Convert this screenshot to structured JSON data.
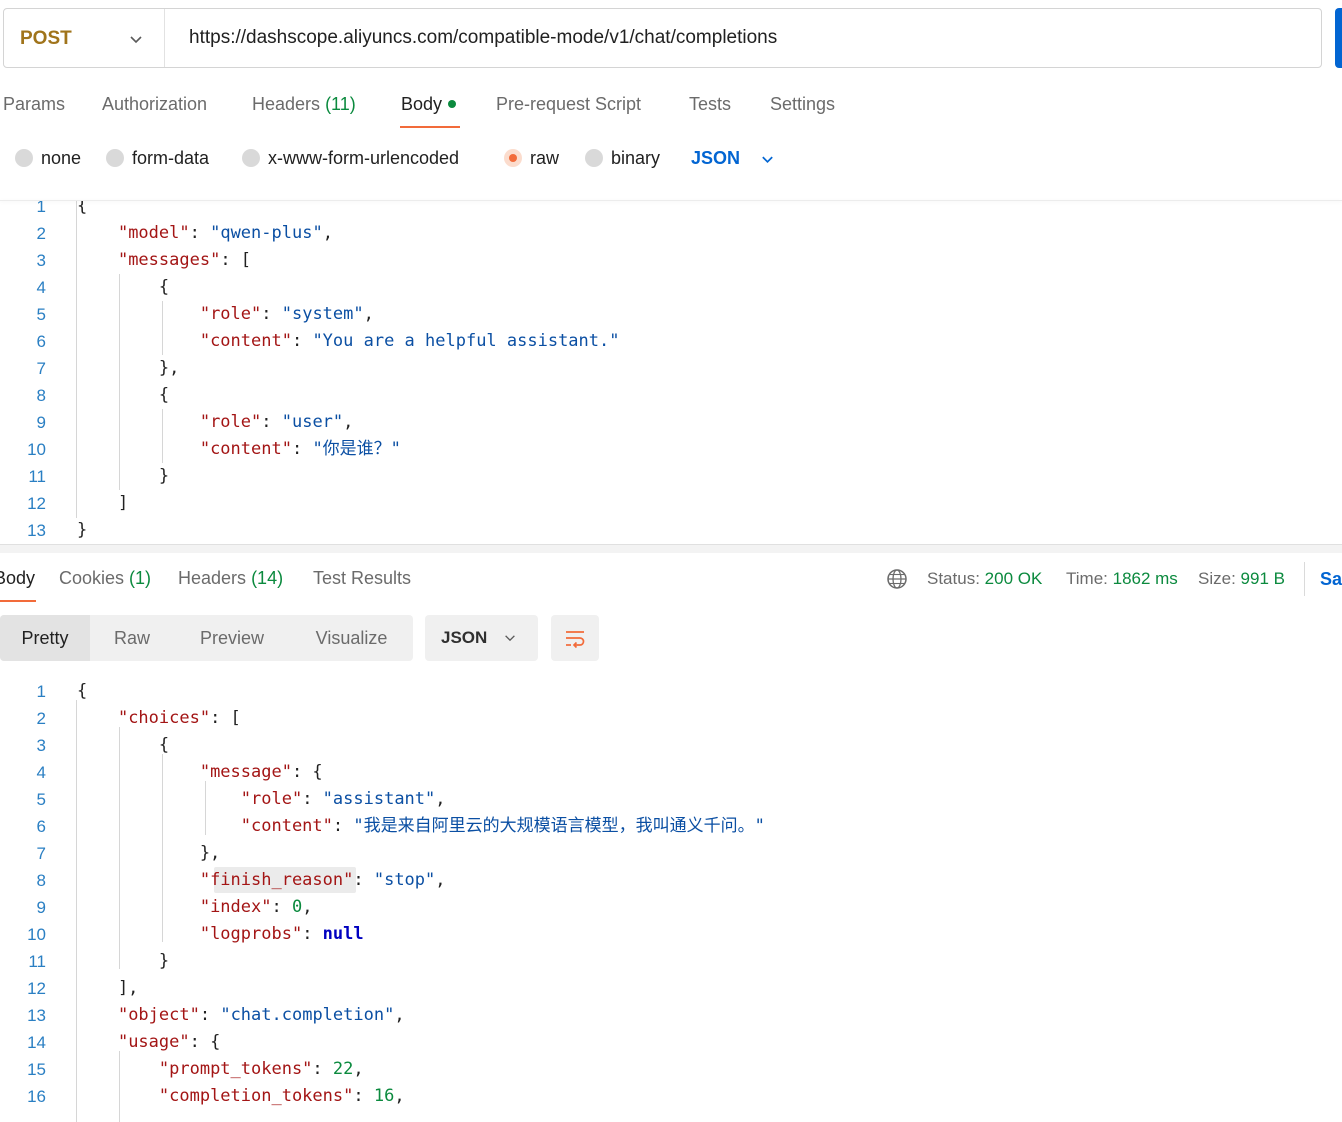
{
  "request": {
    "method": "POST",
    "url": "https://dashscope.aliyuncs.com/compatible-mode/v1/chat/completions"
  },
  "request_tabs": {
    "params": "Params",
    "authorization": "Authorization",
    "headers": "Headers",
    "headers_count": "(11)",
    "body": "Body",
    "pre_request": "Pre-request Script",
    "tests": "Tests",
    "settings": "Settings"
  },
  "body_types": {
    "none": "none",
    "form_data": "form-data",
    "urlencoded": "x-www-form-urlencoded",
    "raw": "raw",
    "binary": "binary",
    "selected": "raw",
    "language": "JSON"
  },
  "request_body": {
    "line_numbers": [
      "1",
      "2",
      "3",
      "4",
      "5",
      "6",
      "7",
      "8",
      "9",
      "10",
      "11",
      "12",
      "13"
    ],
    "lines": [
      "{",
      "    \"model\": \"qwen-plus\",",
      "    \"messages\": [",
      "        {",
      "            \"role\": \"system\",",
      "            \"content\": \"You are a helpful assistant.\"",
      "        },",
      "        {",
      "            \"role\": \"user\",",
      "            \"content\": \"你是谁？\"",
      "        }",
      "    ]",
      "}"
    ]
  },
  "response_tabs": {
    "body": "Body",
    "cookies": "Cookies",
    "cookies_count": "(1)",
    "headers": "Headers",
    "headers_count": "(14)",
    "test_results": "Test Results"
  },
  "response_meta": {
    "status_label": "Status:",
    "status_value": "200 OK",
    "time_label": "Time:",
    "time_value": "1862 ms",
    "size_label": "Size:",
    "size_value": "991 B",
    "save_label": "Sa"
  },
  "response_view": {
    "pretty": "Pretty",
    "raw": "Raw",
    "preview": "Preview",
    "visualize": "Visualize",
    "language": "JSON"
  },
  "response_body": {
    "line_numbers": [
      "1",
      "2",
      "3",
      "4",
      "5",
      "6",
      "7",
      "8",
      "9",
      "10",
      "11",
      "12",
      "13",
      "14",
      "15",
      "16"
    ],
    "lines": [
      "{",
      "    \"choices\": [",
      "        {",
      "            \"message\": {",
      "                \"role\": \"assistant\",",
      "                \"content\": \"我是来自阿里云的大规模语言模型，我叫通义千问。\"",
      "            },",
      "            \"finish_reason\": \"stop\",",
      "            \"index\": 0,",
      "            \"logprobs\": null",
      "        }",
      "    ],",
      "    \"object\": \"chat.completion\",",
      "    \"usage\": {",
      "        \"prompt_tokens\": 22,",
      "        \"completion_tokens\": 16,"
    ]
  },
  "colors": {
    "accent": "#f26b3a",
    "brand_blue": "#0265d2",
    "success": "#0b8a3e",
    "method": "#a0741b"
  },
  "icons": {
    "method_chevron": "chevron-down-icon",
    "language_chevron": "chevron-down-icon",
    "globe": "globe-icon",
    "wrap": "wrap-lines-icon"
  }
}
